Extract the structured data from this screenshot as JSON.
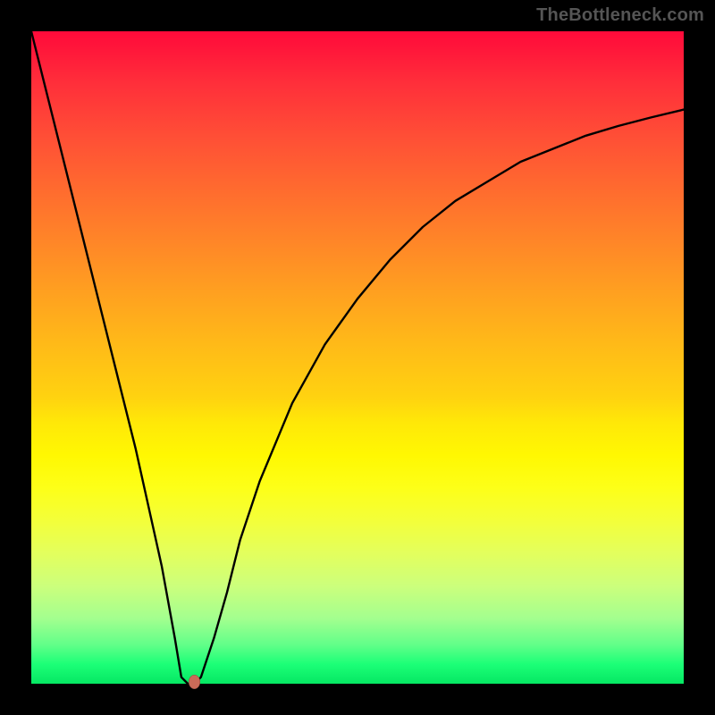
{
  "watermark": "TheBottleneck.com",
  "chart_data": {
    "type": "line",
    "title": "",
    "xlabel": "",
    "ylabel": "",
    "xlim": [
      0,
      100
    ],
    "ylim": [
      0,
      100
    ],
    "grid": false,
    "legend": false,
    "series": [
      {
        "name": "curve",
        "x": [
          0,
          2,
          4,
          6,
          8,
          10,
          12,
          14,
          16,
          18,
          20,
          22,
          23,
          24,
          25,
          26,
          28,
          30,
          32,
          35,
          40,
          45,
          50,
          55,
          60,
          65,
          70,
          75,
          80,
          85,
          90,
          95,
          100
        ],
        "y": [
          100,
          92,
          84,
          76,
          68,
          60,
          52,
          44,
          36,
          27,
          18,
          7,
          1,
          0,
          0,
          1,
          7,
          14,
          22,
          31,
          43,
          52,
          59,
          65,
          70,
          74,
          77,
          80,
          82,
          84,
          85.5,
          86.8,
          88
        ]
      }
    ],
    "marker": {
      "x": 25,
      "y": 0,
      "color": "#c96a58"
    },
    "background_gradient": {
      "top": "#ff0a3a",
      "bottom": "#06e763"
    },
    "frame_color": "#000000"
  }
}
